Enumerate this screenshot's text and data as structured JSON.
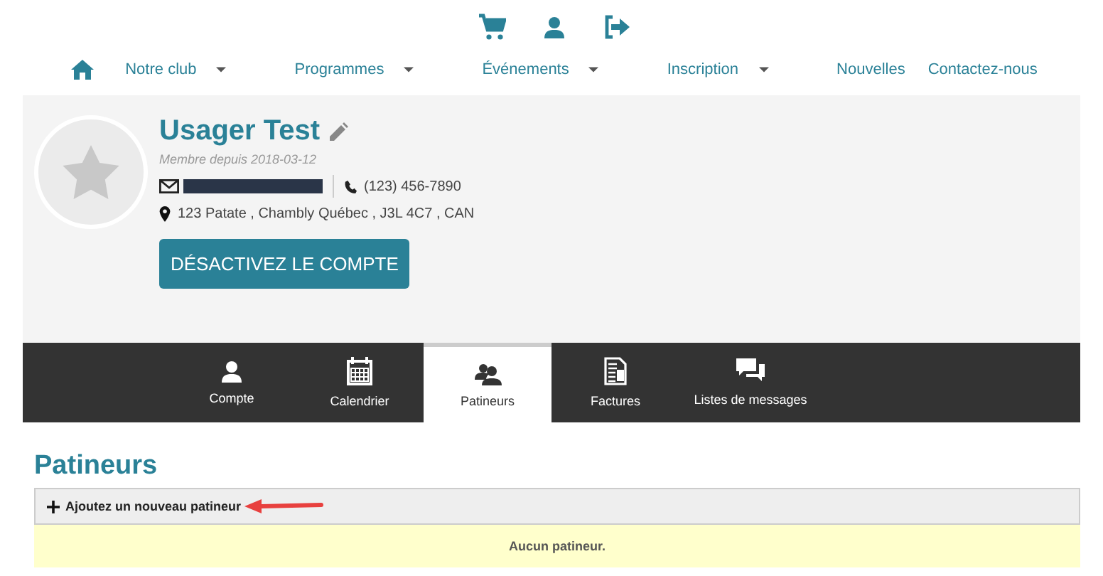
{
  "top_icons": [
    {
      "kind": "cart"
    },
    {
      "kind": "user"
    },
    {
      "kind": "logout"
    }
  ],
  "nav": [
    {
      "label": "Notre club",
      "dropdown": true
    },
    {
      "label": "Programmes",
      "dropdown": true
    },
    {
      "label": "Événements",
      "dropdown": true
    },
    {
      "label": "Inscription",
      "dropdown": true
    },
    {
      "label": "Nouvelles",
      "dropdown": false
    },
    {
      "label": "Contactez-nous",
      "dropdown": false
    }
  ],
  "profile": {
    "name": "Usager Test",
    "member_since": "Membre depuis 2018-03-12",
    "phone": "(123) 456-7890",
    "address": "123 Patate , Chambly Québec , J3L 4C7 , CAN",
    "deactivate_button": "DÉSACTIVEZ LE COMPTE"
  },
  "tabs": [
    {
      "label": "Compte",
      "kind": "user",
      "selected": false
    },
    {
      "label": "Calendrier",
      "kind": "calendar",
      "selected": false
    },
    {
      "label": "Patineurs",
      "kind": "users",
      "selected": true
    },
    {
      "label": "Factures",
      "kind": "invoice",
      "selected": false
    },
    {
      "label": "Listes de messages",
      "kind": "chat",
      "selected": false
    }
  ],
  "section": {
    "title": "Patineurs",
    "add_button": "Ajoutez un nouveau patineur",
    "empty_message": "Aucun patineur."
  }
}
